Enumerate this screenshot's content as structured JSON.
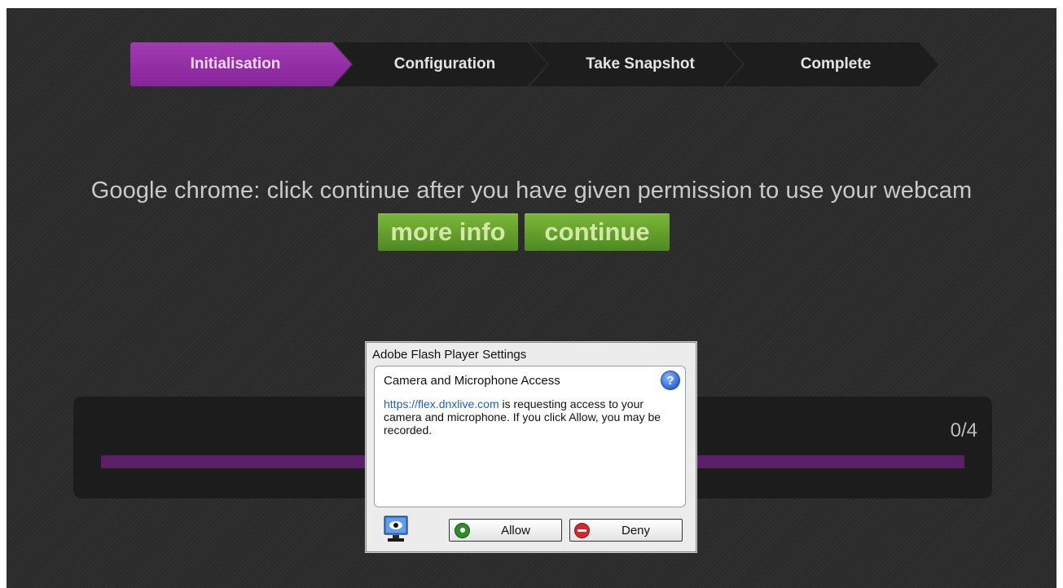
{
  "steps": [
    {
      "label": "Initialisation",
      "active": true
    },
    {
      "label": "Configuration",
      "active": false
    },
    {
      "label": "Take Snapshot",
      "active": false
    },
    {
      "label": "Complete",
      "active": false
    }
  ],
  "message": "Google chrome: click continue after you have given permission to use your webcam",
  "buttons": {
    "more_info": "more info",
    "continue": "continue"
  },
  "progress": {
    "count_text": "0/4",
    "fraction": 0
  },
  "flash_dialog": {
    "title": "Adobe Flash Player Settings",
    "heading": "Camera and Microphone Access",
    "help_icon": "?",
    "link_text": "https://flex.dnxlive.com",
    "body_text": " is requesting access to your camera and microphone. If you click Allow, you may be recorded.",
    "allow_label": "Allow",
    "deny_label": "Deny"
  },
  "colors": {
    "accent_purple": "#8d2fa0",
    "button_green": "#66a22e",
    "background": "#2b2b2b"
  },
  "icons": {
    "help": "help-icon",
    "camera_privacy": "camera-privacy-icon",
    "allow": "allow-icon",
    "deny": "deny-icon"
  }
}
